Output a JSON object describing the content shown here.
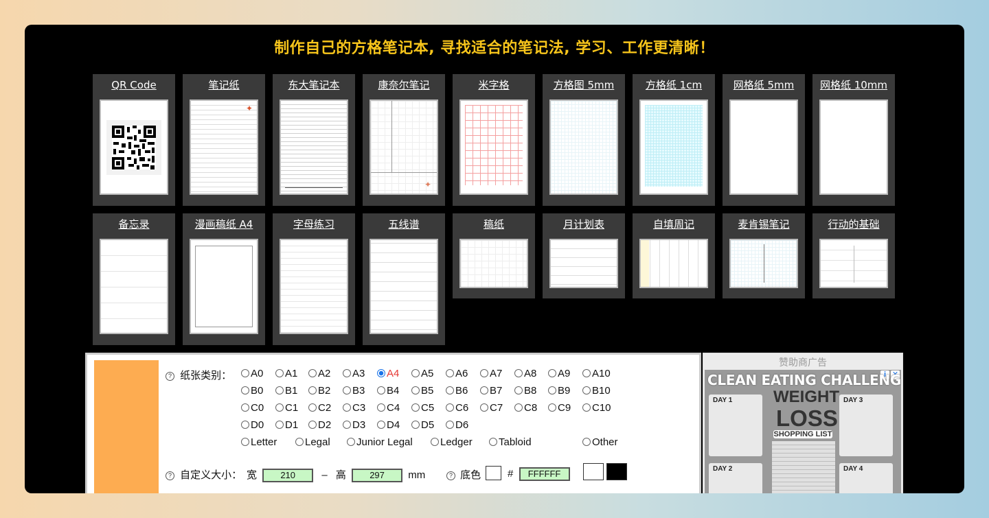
{
  "header": {
    "title": "制作自己的方格笔记本, 寻找适合的笔记法, 学习、工作更清晰！"
  },
  "templates_row1": [
    {
      "label": "QR Code"
    },
    {
      "label": "笔记纸"
    },
    {
      "label": "东大笔记本"
    },
    {
      "label": "康奈尔笔记"
    },
    {
      "label": "米字格"
    },
    {
      "label": "方格图 5mm"
    },
    {
      "label": "方格纸 1cm"
    },
    {
      "label": "网格纸 5mm"
    },
    {
      "label": "网格纸 10mm"
    }
  ],
  "templates_row2": [
    {
      "label": "备忘录"
    },
    {
      "label": "漫画稿纸 A4"
    },
    {
      "label": "字母练习"
    },
    {
      "label": "五线谱"
    },
    {
      "label": "稿纸"
    },
    {
      "label": "月计划表"
    },
    {
      "label": "自填周记"
    },
    {
      "label": "麦肯锡笔记"
    },
    {
      "label": "行动的基础"
    }
  ],
  "paper": {
    "help_icon": "?",
    "label": "纸张类别：",
    "a_sizes": [
      "A0",
      "A1",
      "A2",
      "A3",
      "A4",
      "A5",
      "A6",
      "A7",
      "A8",
      "A9",
      "A10"
    ],
    "b_sizes": [
      "B0",
      "B1",
      "B2",
      "B3",
      "B4",
      "B5",
      "B6",
      "B7",
      "B8",
      "B9",
      "B10"
    ],
    "c_sizes": [
      "C0",
      "C1",
      "C2",
      "C3",
      "C4",
      "C5",
      "C6",
      "C7",
      "C8",
      "C9",
      "C10"
    ],
    "d_sizes": [
      "D0",
      "D1",
      "D2",
      "D3",
      "D4",
      "D5",
      "D6"
    ],
    "us_sizes": [
      "Letter",
      "Legal",
      "Junior Legal",
      "Ledger",
      "Tabloid"
    ],
    "other": "Other",
    "selected": "A4"
  },
  "custom_size": {
    "label": "自定义大小：",
    "width_label": "宽",
    "width_value": "210",
    "dash": "–",
    "height_label": "高",
    "height_value": "297",
    "unit": "mm",
    "bg_label": "底色",
    "hash": "#",
    "bg_value": "FFFFFF"
  },
  "ad": {
    "caption": "赞助商广告",
    "title": "CLEAN EATING CHALLENGE FOR",
    "weight": "WEIGHT",
    "loss": "LOSS",
    "shopping": "SHOPPING LIST",
    "day1": "DAY 1",
    "day2": "DAY 2",
    "day3": "DAY 3",
    "day4": "DAY 4",
    "info_icon": "i",
    "close_icon": "✕"
  },
  "colors": {
    "accent": "#f7c51b",
    "orange": "#fdac51",
    "selected_radio": "#1a73e8",
    "selected_text": "#e53935",
    "input_bg": "#c8f7c5"
  }
}
